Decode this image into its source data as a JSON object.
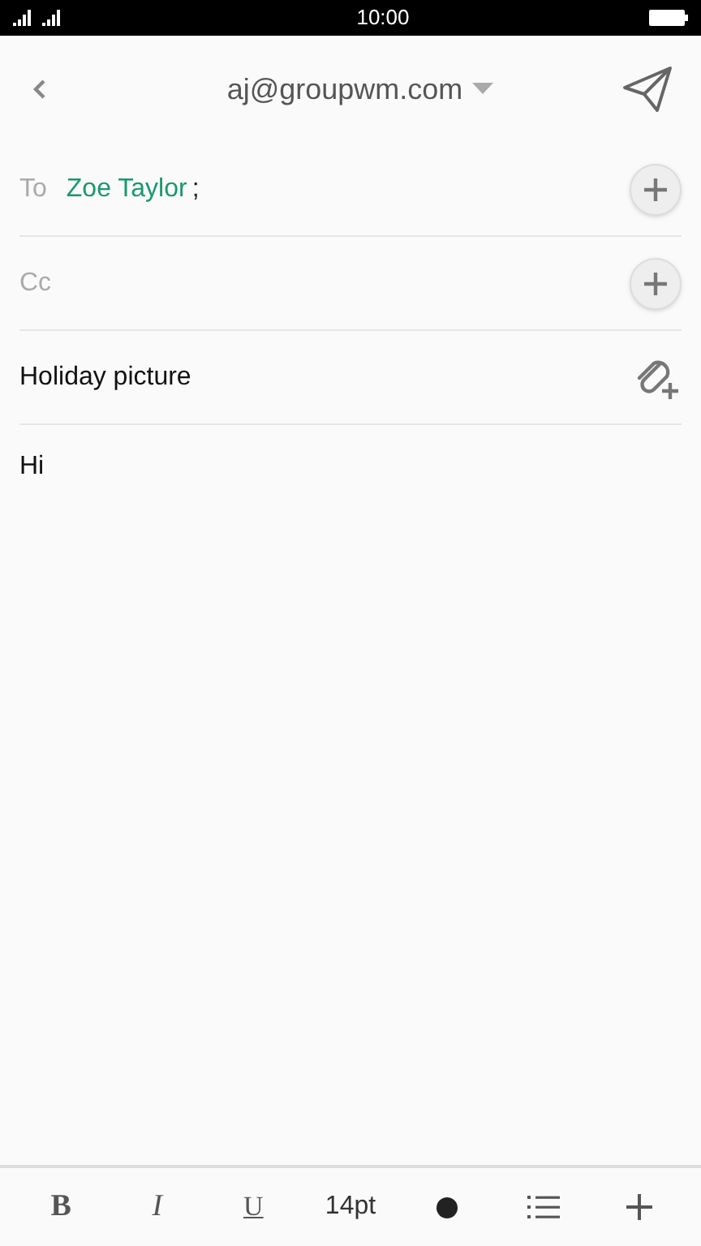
{
  "status_bar": {
    "time": "10:00"
  },
  "header": {
    "account": "aj@groupwm.com"
  },
  "to": {
    "label": "To",
    "recipients": [
      {
        "name": "Zoe Taylor",
        "separator": ";"
      }
    ]
  },
  "cc": {
    "label": "Cc"
  },
  "subject": {
    "value": "Holiday picture"
  },
  "body": {
    "value": "Hi"
  },
  "toolbar": {
    "bold": "B",
    "italic": "I",
    "underline": "U",
    "font_size": "14pt"
  }
}
